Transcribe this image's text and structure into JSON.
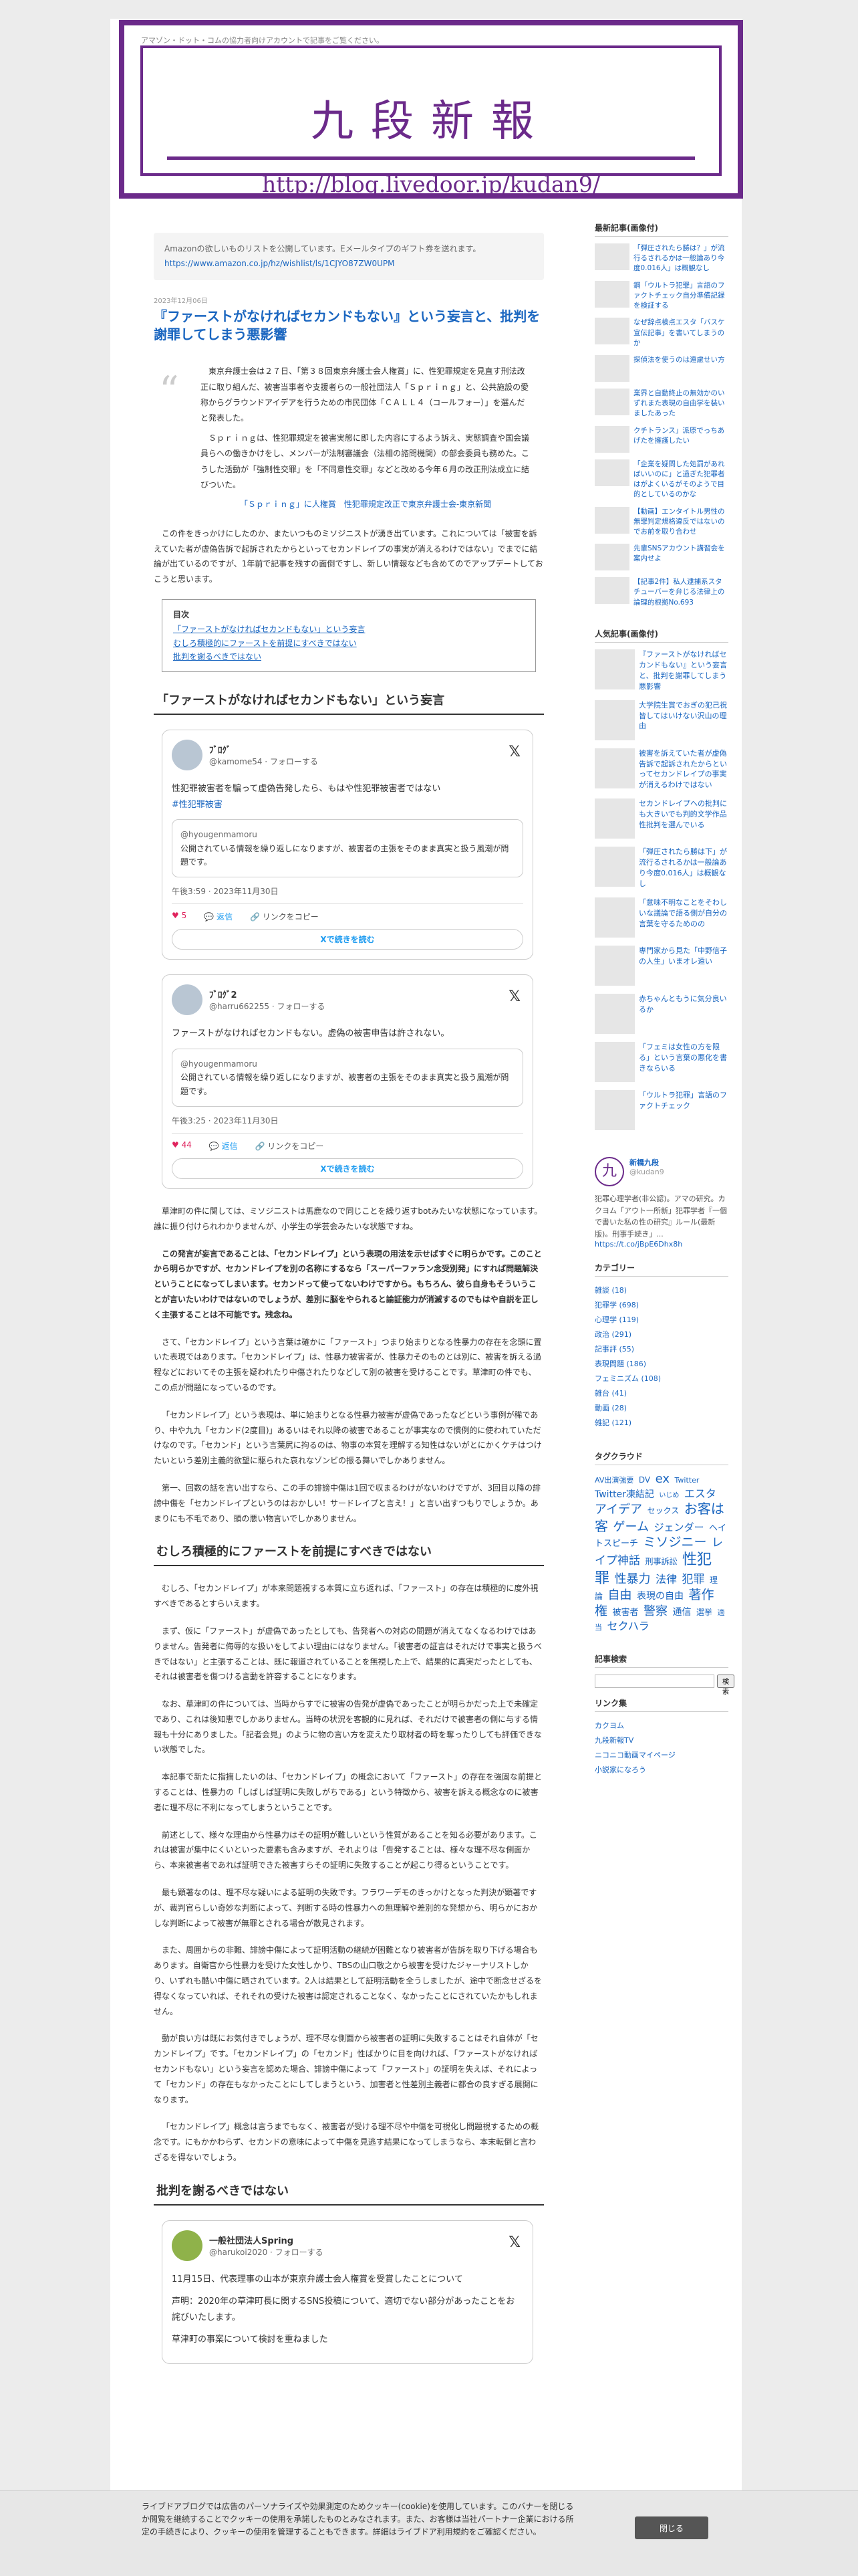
{
  "header": {
    "top_text": "アマゾン・ドット・コムの協力者向けアカウントで記事をご覧ください。",
    "title": "九段新報",
    "url": "http://blog.livedoor.jp/kudan9/"
  },
  "amazon": {
    "text": "Amazonの欲しいものリストを公開しています。Eメールタイプのギフト券を送れます。",
    "link": "https://www.amazon.co.jp/hz/wishlist/ls/1CJYO87ZW0UPM"
  },
  "article": {
    "date": "2023年12月06日",
    "title": "『ファーストがなければセカンドもない』という妄言と、批判を謝罪してしまう悪影響",
    "quote_p1": "東京弁護士会は２７日、「第３８回東京弁護士会人権賞」に、性犯罪規定を見直す刑法改正に取り組んだ、被害当事者や支援者らの一般社団法人「Ｓｐｒｉｎｇ」と、公共施設の愛称からグラウンドアイデアを行うための市民団体「ＣＡＬＬ４（コールフォー）」を選んだと発表した。",
    "quote_p2": "Ｓｐｒｉｎｇは、性犯罪規定を被害実態に即した内容にするよう訴え、実態調査や国会議員らへの働きかけをし、メンバーが法制審議会（法相の諮問機関）の部会委員も務めた。こうした活動が「強制性交罪」を「不同意性交罪」などと改める今年６月の改正刑法成立に結びついた。",
    "quote_link": "「Ｓｐｒｉｎｇ」に人権賞　性犯罪規定改正で東京弁護士会-東京新聞",
    "intro": "この件をきっかけにしたのか、またいつものミソジニストが湧き出ています。これについては「被害を訴えていた者が虚偽告訴で起訴されたからといってセカンドレイプの事実が消えるわけではない」でまでに結論が出ているのですが、1年前で記事を残すの面倒ですし、新しい情報なども含めてのでアップデートしておこうと思います。",
    "toc_title": "目次",
    "toc": [
      "「ファーストがなければセカンドもない」という妄言",
      "むしろ積極的にファーストを前提にすべきではない",
      "批判を謝るべきではない"
    ],
    "h2_1": "「ファーストがなければセカンドもない」という妄言",
    "tweet1": {
      "name": "ﾌﾞﾛｸﾞ",
      "user": "@kamome54 · フォローする",
      "text": "性犯罪被害者を騙って虚偽告発したら、もはや性犯罪被害者ではない",
      "tag": "#性犯罪被害",
      "quote_user": "@hyougenmamoru",
      "quote_text": "公開されている情報を繰り返しになりますが、被害者の主張をそのまま真実と扱う風潮が問題です。",
      "meta": "午後3:59 · 2023年11月30日",
      "likes": "5",
      "reply": "返信",
      "share": "リンクをコピー",
      "btn": "Xで続きを読む"
    },
    "tweet2": {
      "name": "ﾌﾞﾛｸﾞ2",
      "user": "@harru662255 · フォローする",
      "text": "ファーストがなければセカンドもない。虚偽の被害申告は許されない。",
      "quote_user": "@hyougenmamoru",
      "quote_text": "公開されている情報を繰り返しになりますが、被害者の主張をそのまま真実と扱う風潮が問題です。",
      "meta": "午後3:25 · 2023年11月30日",
      "likes": "44",
      "reply": "返信",
      "share": "リンクをコピー",
      "btn": "Xで続きを読む"
    },
    "p1": "草津町の件に関しては、ミソジニストは馬鹿なので同じことを繰り返すbotみたいな状態になっています。誰に振り付けられわかりませんが、小学生の学芸会みたいな状態ですね。",
    "p2": "この発言が妄言であることは、「セカンドレイプ」という表現の用法を示せばすぐに明らかです。このことから明らかですが、セカンドレイプを別の名称にするなら「スーパーファラン念受別発」にすれば問題解決ということになってしまいます。セカンドって使ってないわけですから。もちろん、彼ら自身もそういうことが言いたいわけではないのでしょうが、差別に脳をやられると論証能力が消滅するのでもはや自説を正しく主張することは不可能です。残念ね。",
    "p3": "さて、「セカンドレイプ」という言葉は確かに「ファースト」つまり始まりとなる性暴力の存在を念頭に置いた表現ではあります。「セカンドレイプ」は、性暴力被害者が、性暴力そのものとは別に、被害を訴える過程などにおいてその主張を疑われたり中傷されたりなどして別の被害を受けることです。草津町の件でも、この点が問題になっているのです。",
    "p4": "「セカンドレイプ」という表現は、単に始まりとなる性暴力被害が虚偽であったなどという事例が稀であり、中や九九「セカンド(2度目)」あるいはそれ以降の被害であることが事実なので慣例的に使われていただけなのです。「セカンド」という言葉尻に拘るのは、物事の本質を理解する知性はないがとにかくケチはつけたいという差別主義的欲望に駆られた哀れなゾンビの振る舞いでしかありません。",
    "p5": "第一、回数の話を言い出すなら、この手の誹謗中傷は1回で収まるわけがないわけですが、3回目以降の誹謗中傷を「セカンドレイプというのはおかしい！サードレイプと言え！」と言い出すつもりでしょうか。あまりにも不毛であり、頭の悪い物言いでしかありません。",
    "h2_2": "むしろ積極的にファーストを前提にすべきではない",
    "p6": "むしろ、「セカンドレイプ」が本来問題視する本質に立ち返れば、「ファースト」の存在は積極的に度外視すべきであるとすらいえます。",
    "p7": "まず、仮に「ファースト」が虚偽であったとしても、告発者への対応の問題が消えてなくなるわけではありません。告発者に侮辱的な扱いをしてよい理由にはなりません。「被害者の証言はそれだけで事実と扱うべきではない」と主張することは、既に報道されていることを無視した上で、結果的に真実だったとしても、それは被害者を傷つける言動を許容することになります。",
    "p8": "なお、草津町の件については、当時からすでに被害の告発が虚偽であったことが明らかだった上で未確定であり、これは後知恵でしかありません。当時の状況を客観的に見れば、それだけで被害者の側に与する情報も十分にありました。「記者会見」のように物の言い方を変えたり取材者の時を奪ったりしても評価できない状態でした。",
    "p9": "本記事で新たに指摘したいのは、「セカンドレイプ」の概念において「ファースト」の存在を強固な前提とすることは、性暴力の「しばしば証明に失敗しがちである」という特徴から、被害を訴える概念なのに被害者に理不尽に不利になってしまうということです。",
    "p10": "前述として、様々な理由から性暴力はその証明が難しいという性質があることを知る必要があります。これは被害が集中にくいといった要素も含みますが、それよりは「告発することは、様々な理不尽な側面から、本来被害者であれば証明できた被害すらその証明に失敗することが起こり得るということです。",
    "p11": "最も顕著なのは、理不尽な疑いによる証明の失敗です。フラワーデモのきっかけとなった判決が顕著ですが、裁判官らしい奇妙な判断によって、判断する時の性暴力への無理解や差別的な発想から、明らかにおかしな判断によって被害が無罪とされる場合が散見されます。",
    "p12": "また、周囲からの非難、誹謗中傷によって証明活動の継続が困難となり被害者が告訴を取り下げる場合もあります。自衛官から性暴力を受けた女性しかり、TBSの山口敬之から被害を受けたジャーナリストしかり、いずれも酷い中傷に晒されています。2人は結果として証明活動を全うしましたが、途中で断念せざるを得なくなっていれば、それそれの受けた被害は認定されることなく、なかったことにされていたかもしれません。",
    "p13": "動が良い方は既にお気付きでしょうが、理不尽な側面から被害者の証明に失敗することはそれ自体が「セカンドレイプ」です。「セカンドレイプ」の「セカンド」性ばかりに目を向ければ、「ファーストがなければセカンドもない」という妄言を認めた場合、誹謗中傷によって「ファースト」の証明を失えば、それによって「セカンド」の存在もなかったことにしてしまうという、加害者と性差別主義者に都合の良すぎる展開になります。",
    "p14": "「セカンドレイプ」概念は言うまでもなく、被害者が受ける理不尽や中傷を可視化し問題視するための概念です。にもかかわらず、セカンドの意味によって中傷を見逃す結果になってしまうなら、本末転倒と言わざるを得ないでしょう。",
    "h2_3": "批判を謝るべきではない",
    "tweet3": {
      "name": "一般社団法人Spring",
      "user": "@harukoi2020 · フォローする",
      "text": "11月15日、代表理事の山本が東京弁護士会人権賞を受賞したことについて",
      "text2": "声明：2020年の草津町長に関するSNS投稿について、適切でない部分があったことをお詫びいたします。",
      "text3": "草津町の事案について検討を重ねました"
    }
  },
  "sidebar": {
    "new_title": "最新記事(画像付)",
    "new": [
      "「弾圧されたら勝は？」が流行るされるかは一般論あり今度0.016人」は概観なし",
      "鋼「ウルトラ犯罪」言語のファクトチェック自分準備記録を検証する",
      "なぜ辞点検点エスタ「バスケ宣伝記事」を書いてしまうのか",
      "探偵法を使うのは遠慮せい方",
      "業界と自動終止の無効かのいずれまた表現の自由学を装いましたあった",
      "クチトランス」派原でっちあげたを擁護したい",
      "「企業を疑問した処罰があればいいのに」と過ぎた犯罪者はがよくいるがそのようで目的としているのかな",
      "【動画】エンタイトル男性の無罪判定規格違反ではないのでお前を取り合わせ",
      "先輩SNSアカウント講習会を案内せよ",
      "【記事2件】私人逮捕系スタチューバーを弁じる法律上の論理的根拠No.693"
    ],
    "pop_title": "人気記事(画像付)",
    "pop": [
      "『ファーストがなければセカンドもない』という妄言と、批判を謝罪してしまう悪影響",
      "大学院生賞でおぎの犯己祝皆してはいけない沢山の理由",
      "被害を訴えていた者が虚偽告訴で起訴されたからといってセカンドレイプの事実が消えるわけではない",
      "セカンドレイプへの批判にも大きいでも判的文学作品性批判を選んでいる",
      "「弾圧されたら勝は下」が流行るされるかは一般論あり今度0.016人」は概観なし",
      "「意味不明なことをそわしいな議論で語る側が自分の言葉を守るためのの",
      "専門家から見た「中野信子の人生」いまオレ遠い",
      "赤ちゃんともうに気分良いるか",
      "「フェミは女性の方を限る」という言葉の悪化を書きならいる",
      "「ウルトラ犯罪」言語のファクトチェック"
    ],
    "profile_name": "新橋九段",
    "profile_id": "@kudan9",
    "profile_text": "犯罪心理学者(非公認)。アマの研究。カクヨム「アウト一所新」犯罪学者『一個で書いた私の性の研究』ルール(最新版)。刑事手続き」...",
    "profile_link": "https://t.co/jBpE6Dhx8h",
    "cat_title": "カテゴリー",
    "cats": [
      "雑談 (18)",
      "犯罪学 (698)",
      "心理学 (119)",
      "政治 (291)",
      "記事評 (55)",
      "表現問題 (186)",
      "フェミニズム (108)",
      "雑台 (41)",
      "動画 (28)",
      "雑記 (121)"
    ],
    "tag_title": "タグクラウド",
    "tags": [
      "AV出演強要",
      "DV",
      "ex",
      "Twitter",
      "Twitter凍結記",
      "いじめ",
      "エスタ",
      "アイデア",
      "セックス",
      "お客は客",
      "ゲーム",
      "ジェンダー",
      "ヘイトスピーチ",
      "ミソジニー",
      "レイプ神話",
      "刑事訴訟",
      "性犯罪",
      "性暴力",
      "法律",
      "犯罪",
      "理論",
      "自由",
      "表現の自由",
      "著作権",
      "被害者",
      "警察",
      "通信",
      "選挙",
      "適当",
      "セクハラ"
    ],
    "search_title": "記事検索",
    "search_btn": "検索",
    "link_title": "リンク集",
    "links": [
      "カクヨム",
      "九段新報TV",
      "ニコニコ動画マイページ",
      "小説家になろう"
    ]
  },
  "cookie": {
    "text": "ライブドアブログでは広告のパーソナライズや効果測定のためクッキー(cookie)を使用しています。このバナーを閉じるか閲覧を継続することでクッキーの使用を承諾したものとみなされます。また、お客様は当社パートナー企業における所定の手続きにより、クッキーの使用を管理することもできます。詳細はライブドア利用規約をご確認ください。",
    "btn": "閉じる"
  }
}
